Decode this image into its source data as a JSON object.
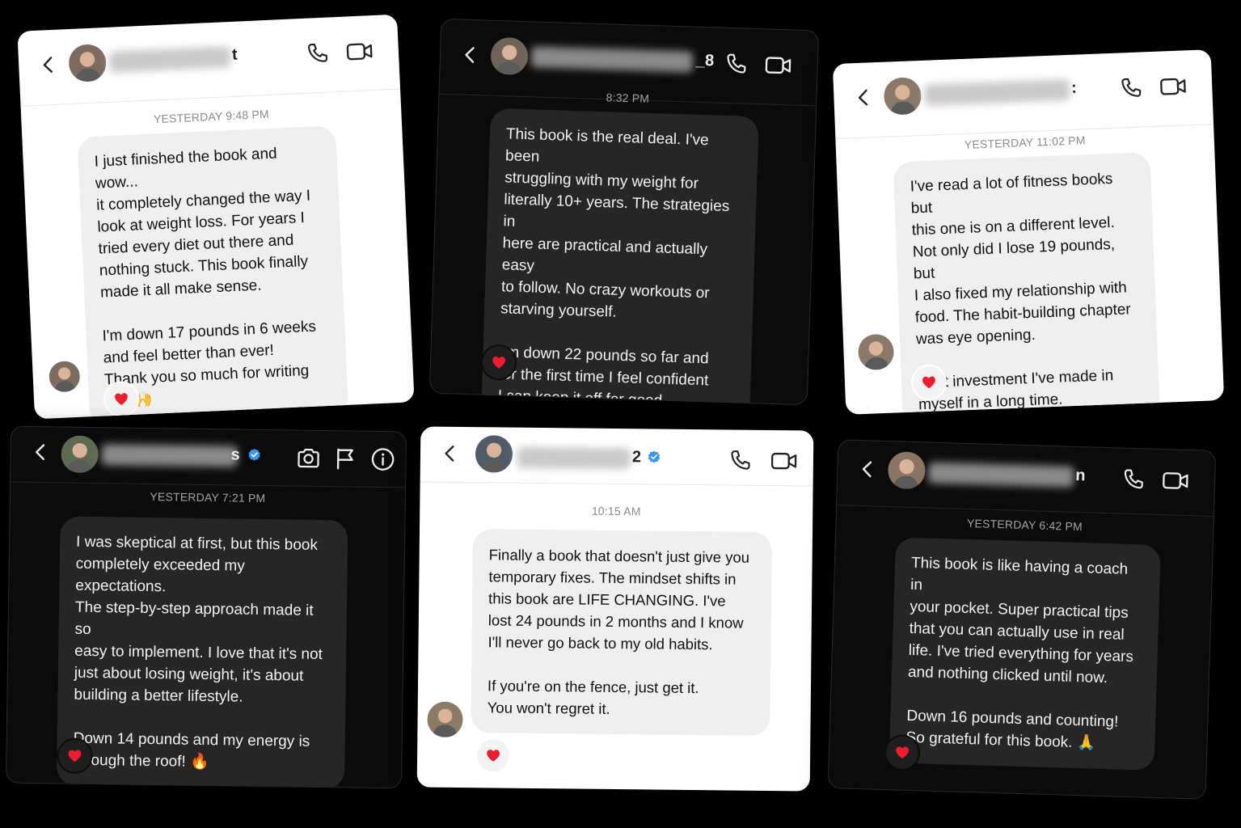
{
  "cards": [
    {
      "theme": "light",
      "name_visible": "t",
      "header_icons": [
        "phone-icon",
        "video-icon"
      ],
      "timestamp": "YESTERDAY 9:48 PM",
      "message": "I just finished the book and wow...\nit completely changed the way I\nlook at weight loss. For years I\ntried every diet out there and\nnothing stuck. This book finally\nmade it all make sense.\n\nI'm down 17 pounds in 6 weeks\nand feel better than ever!\nThank you so much for writing\nthis 🙌",
      "reaction": "❤️"
    },
    {
      "theme": "dark",
      "name_visible": "_8",
      "header_icons": [
        "phone-icon",
        "video-icon"
      ],
      "timestamp": "8:32 PM",
      "message": "This book is the real deal. I've been\nstruggling with my weight for\nliterally 10+ years. The strategies in\nhere are practical and actually easy\nto follow. No crazy workouts or\nstarving yourself.\n\nI'm down 22 pounds so far and\nfor the first time I feel confident\nI can keep it off for good.",
      "reaction": "❤️"
    },
    {
      "theme": "light",
      "name_visible": ":",
      "header_icons": [
        "phone-icon",
        "video-icon"
      ],
      "timestamp": "YESTERDAY 11:02 PM",
      "message": "I've read a lot of fitness books but\nthis one is on a different level.\nNot only did I lose 19 pounds, but\nI also fixed my relationship with\nfood. The habit-building chapter\nwas eye opening.\n\nBest investment I've made in\nmyself in a long time.",
      "reaction": "❤️"
    },
    {
      "theme": "dark",
      "name_visible": "s",
      "verified": true,
      "header_icons": [
        "camera-icon",
        "flag-icon",
        "info-icon"
      ],
      "timestamp": "YESTERDAY 7:21 PM",
      "message": "I was skeptical at first, but this book\ncompletely exceeded my expectations.\nThe step-by-step approach made it so\neasy to implement. I love that it's not\njust about losing weight, it's about\nbuilding a better lifestyle.\n\nDown 14 pounds and my energy is\nthrough the roof! 🔥",
      "reaction": "❤️"
    },
    {
      "theme": "light",
      "name_visible": "2",
      "verified": true,
      "header_icons": [
        "phone-icon",
        "video-icon"
      ],
      "timestamp": "10:15 AM",
      "message": "Finally a book that doesn't just give you\ntemporary fixes. The mindset shifts in\nthis book are LIFE CHANGING. I've\nlost 24 pounds in 2 months and I know\nI'll never go back to my old habits.\n\nIf you're on the fence, just get it.\nYou won't regret it.",
      "reaction": "❤️"
    },
    {
      "theme": "dark",
      "name_visible": "n",
      "header_icons": [
        "phone-icon",
        "video-icon"
      ],
      "timestamp": "YESTERDAY 6:42 PM",
      "message": "This book is like having a coach in\nyour pocket. Super practical tips\nthat you can actually use in real\nlife. I've tried everything for years\nand nothing clicked until now.\n\nDown 16 pounds and counting!\nSo grateful for this book. 🙏",
      "reaction": "❤️"
    }
  ]
}
